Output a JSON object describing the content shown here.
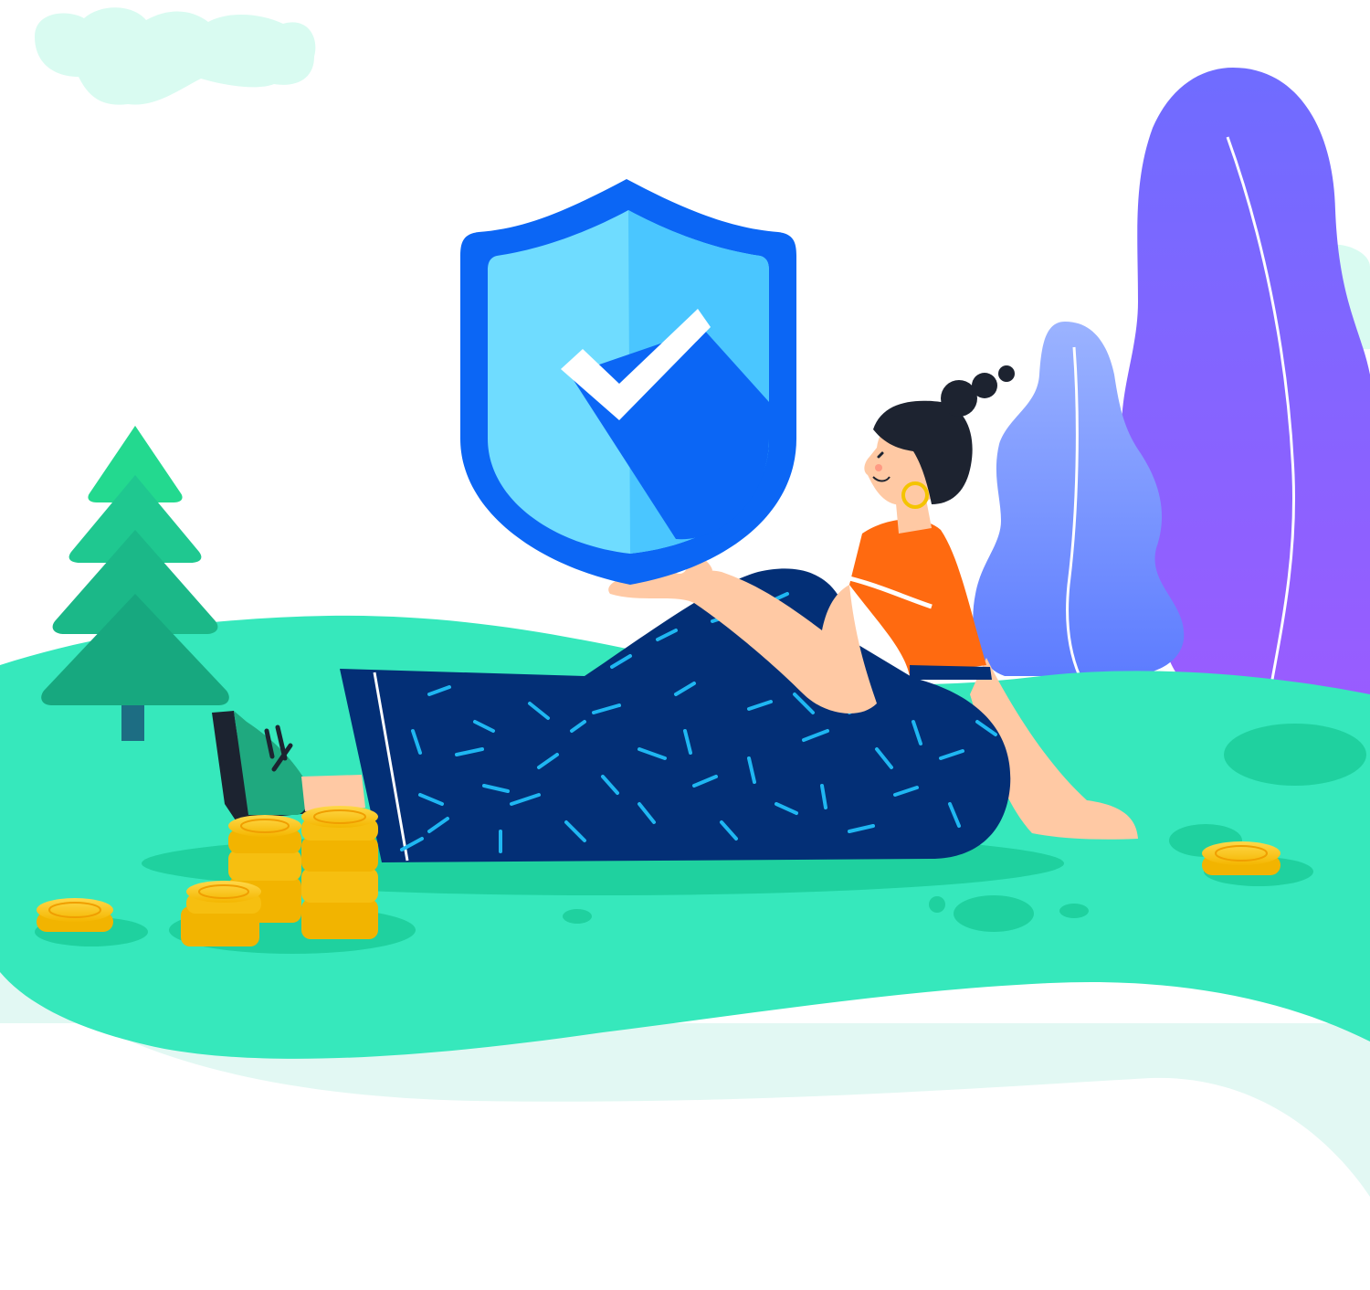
{
  "illustration": {
    "subject": "person-holding-security-shield",
    "icons": [
      "cloud-icon",
      "tree-icon",
      "shield-check-icon",
      "coin-stack-icon",
      "leaf-plant-icon"
    ],
    "colors": {
      "background": "#ffffff",
      "ground": "#36e8bc",
      "ground_shadow": "#1fd19f",
      "mist": "#e2f8f3",
      "cloud": "#d9fbf1",
      "tree": "#1fb98f",
      "tree_trunk": "#1d6d83",
      "shield_outer": "#0b66f5",
      "shield_inner_left": "#6fdcff",
      "shield_inner_right": "#4ac6ff",
      "check": "#ffffff",
      "pants": "#032f76",
      "pants_pattern": "#1fb7f2",
      "shirt": "#ff6a10",
      "skin": "#ffc9a4",
      "hair": "#1d2330",
      "earring": "#f4c400",
      "coin": "#fcc91c",
      "coin_edge": "#f1b300",
      "plant_purple": "#8c5bff",
      "plant_blue": "#6b8cff"
    }
  }
}
